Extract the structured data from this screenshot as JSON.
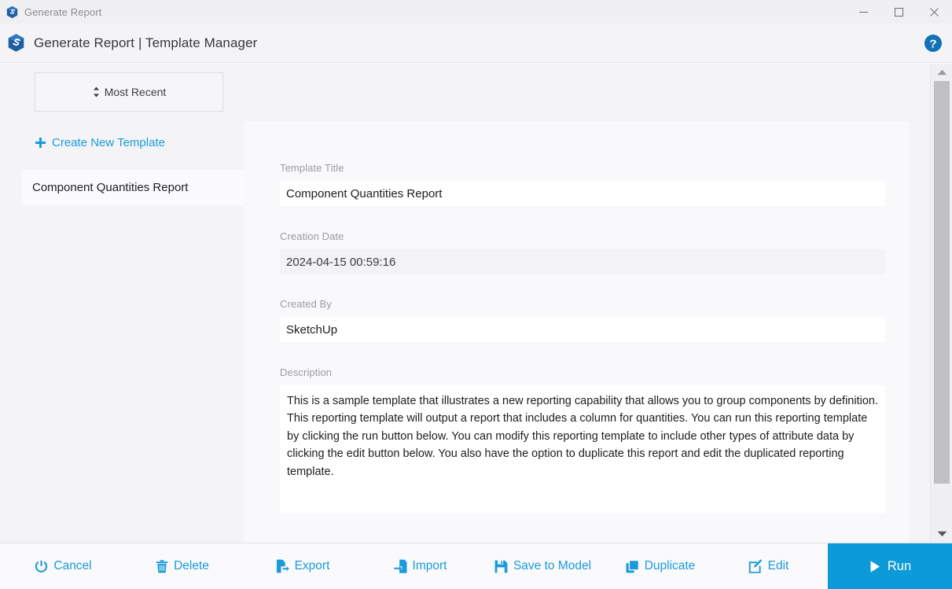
{
  "window": {
    "title": "Generate Report",
    "logo_icon": "sketchup-logo-icon",
    "minimize_icon": "minimize-icon",
    "maximize_icon": "maximize-icon",
    "close_icon": "close-icon"
  },
  "header": {
    "title": "Generate Report | Template Manager",
    "logo_icon": "sketchup-logo-icon",
    "help_icon": "help-circle-icon"
  },
  "sidebar": {
    "sort": {
      "label": "Most Recent",
      "icon": "sort-updown-icon"
    },
    "create_new": {
      "label": "Create New Template",
      "icon": "plus-icon"
    },
    "templates": [
      {
        "label": "Component Quantities Report",
        "selected": true
      }
    ]
  },
  "form": {
    "title_label": "Template Title",
    "title_value": "Component Quantities Report",
    "title_placeholder": "Template Title",
    "creation_date_label": "Creation Date",
    "creation_date_value": "2024-04-15 00:59:16",
    "created_by_label": "Created By",
    "created_by_value": "SketchUp",
    "created_by_placeholder": "Created By",
    "description_label": "Description",
    "description_value": "This is a sample template that illustrates a new reporting capability that allows you to group components by definition. This reporting template will output a report that includes a column for quantities. You can run this reporting template by clicking the run button below. You can modify this reporting template to include other types of attribute data by clicking the edit button below. You also have the option to duplicate this report and edit the duplicated reporting template.",
    "description_placeholder": "Description"
  },
  "scrollbar": {
    "up_icon": "triangle-up-icon",
    "down_icon": "triangle-down-icon"
  },
  "toolbar": {
    "cancel": {
      "label": "Cancel",
      "icon": "power-icon"
    },
    "delete": {
      "label": "Delete",
      "icon": "trash-icon"
    },
    "export": {
      "label": "Export",
      "icon": "file-export-icon"
    },
    "import": {
      "label": "Import",
      "icon": "file-import-icon"
    },
    "save_to_model": {
      "label": "Save to Model",
      "icon": "floppy-disk-icon"
    },
    "duplicate": {
      "label": "Duplicate",
      "icon": "copy-icon"
    },
    "edit": {
      "label": "Edit",
      "icon": "pencil-square-icon"
    },
    "run": {
      "label": "Run",
      "icon": "play-icon"
    }
  },
  "colors": {
    "accent": "#1a9ada",
    "run_button": "#0c9bd8",
    "window_bg": "#f0f0f3",
    "panel_bg": "#f4f4f7",
    "card_bg": "#f9f9fb"
  }
}
